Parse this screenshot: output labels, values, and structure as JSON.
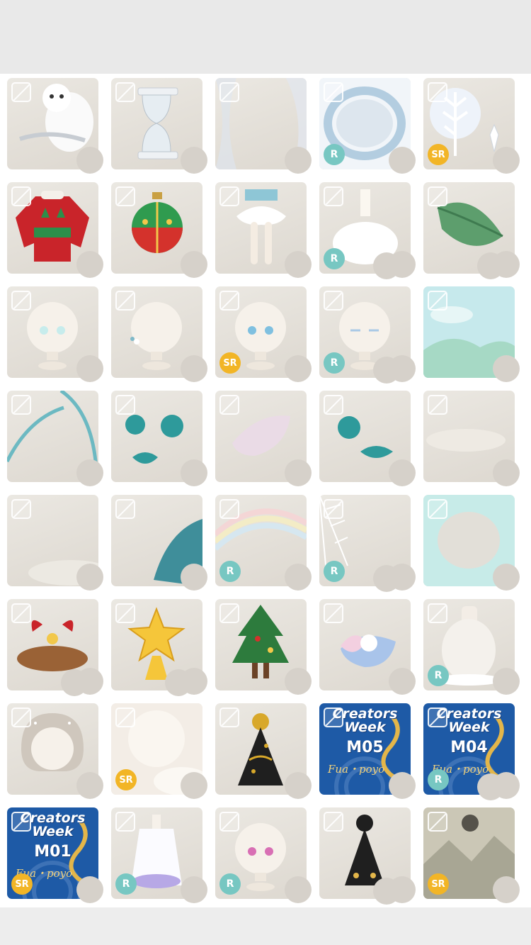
{
  "grid": {
    "tiles": [
      {
        "item": "snowy-owl",
        "badge": ""
      },
      {
        "item": "hourglass",
        "badge": ""
      },
      {
        "item": "sheer-curtain",
        "badge": ""
      },
      {
        "item": "frost-frame",
        "badge": "R"
      },
      {
        "item": "crystal-sprig",
        "badge": "SR"
      },
      {
        "item": "christmas-sweater",
        "badge": ""
      },
      {
        "item": "christmas-ornament",
        "badge": ""
      },
      {
        "item": "tutu-skirt-tights",
        "badge": ""
      },
      {
        "item": "white-tulle-dress",
        "badge": "R"
      },
      {
        "item": "leaf-signboard",
        "badge": ""
      },
      {
        "item": "face-glowing-eyes",
        "badge": ""
      },
      {
        "item": "flower-hairpin",
        "badge": ""
      },
      {
        "item": "face-blue-eyes",
        "badge": "SR"
      },
      {
        "item": "face-closed-eyes",
        "badge": "R"
      },
      {
        "item": "sky-meadow-background",
        "badge": ""
      },
      {
        "item": "teal-grass-blades",
        "badge": ""
      },
      {
        "item": "teal-leaves",
        "badge": ""
      },
      {
        "item": "pink-petal",
        "badge": ""
      },
      {
        "item": "teal-sprouts",
        "badge": ""
      },
      {
        "item": "fog-cloud",
        "badge": ""
      },
      {
        "item": "low-mist",
        "badge": ""
      },
      {
        "item": "frosted-fern",
        "badge": ""
      },
      {
        "item": "rainbow",
        "badge": "R"
      },
      {
        "item": "spiderweb-lights",
        "badge": "R"
      },
      {
        "item": "mint-vignette",
        "badge": ""
      },
      {
        "item": "pinecone-bow",
        "badge": ""
      },
      {
        "item": "star-topper",
        "badge": ""
      },
      {
        "item": "christmas-tree",
        "badge": ""
      },
      {
        "item": "pearl-shell",
        "badge": ""
      },
      {
        "item": "glowing-egg-lamp",
        "badge": "R"
      },
      {
        "item": "silver-hair-sparkles",
        "badge": ""
      },
      {
        "item": "cream-clouds",
        "badge": "SR"
      },
      {
        "item": "music-party-hat",
        "badge": ""
      },
      {
        "item": "creators-week-m05",
        "badge": "",
        "cw_title": "Creators Week",
        "cw_code": "M05",
        "cw_sub": "Fua・poyo"
      },
      {
        "item": "creators-week-m04",
        "badge": "R",
        "cw_title": "Creators Week",
        "cw_code": "M04",
        "cw_sub": "Fua・poyo"
      },
      {
        "item": "creators-week-m01",
        "badge": "SR",
        "cw_title": "Creators Week",
        "cw_code": "M01",
        "cw_sub": "Fua・poyo"
      },
      {
        "item": "white-robe-purple-hem",
        "badge": "R"
      },
      {
        "item": "face-pink-eyes",
        "badge": "R"
      },
      {
        "item": "black-pompom-hat",
        "badge": ""
      },
      {
        "item": "moonlit-mountains",
        "badge": "SR"
      }
    ]
  },
  "colors": {
    "badge_r": "#77c7c2",
    "badge_sr": "#f2b526",
    "tile_bg": "#e4e0d9",
    "creators_blue": "#1e5aa6"
  }
}
